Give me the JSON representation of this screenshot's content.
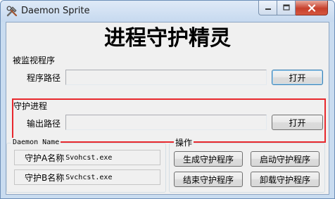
{
  "window": {
    "title": "Daemon Sprite",
    "icon": "tools-icon"
  },
  "heading": "进程守护精灵",
  "monitored": {
    "section_label": "被监视程序",
    "field_label": "程序路径",
    "field_value": "",
    "open_label": "打开"
  },
  "daemon_proc": {
    "section_label": "守护进程",
    "field_label": "输出路径",
    "field_value": "",
    "open_label": "打开"
  },
  "daemon_name": {
    "title": "Daemon Name",
    "rows": [
      {
        "label": "守护A名称",
        "value": "Svohcst.exe"
      },
      {
        "label": "守护B名称",
        "value": "Svchcst.exe"
      }
    ]
  },
  "operations": {
    "title": "操作",
    "buttons": [
      "生成守护程序",
      "启动守护程序",
      "结束守护程序",
      "卸载守护程序"
    ]
  },
  "colors": {
    "highlight_border": "#e8282d",
    "close_button": "#c7402c"
  }
}
